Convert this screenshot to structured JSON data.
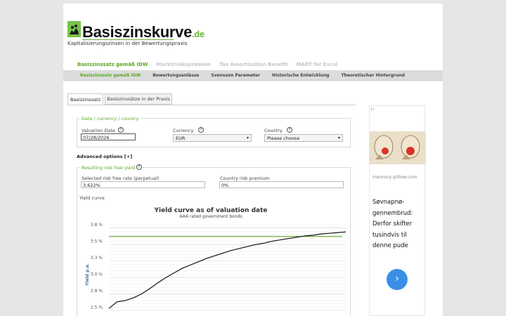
{
  "logo": {
    "name": "Basiszinskurve",
    "tld": ".de",
    "tagline": "Kapitalisierungszinsen in der Bewertungspraxis"
  },
  "top_nav": [
    {
      "label": "Basiszinssatz gemäß IDW",
      "active": true
    },
    {
      "label": "Marktrisikoprämien",
      "active": false
    },
    {
      "label": "Tax Amortisation Benefit",
      "active": false
    },
    {
      "label": "MART for Excel",
      "active": false
    }
  ],
  "sub_nav": [
    {
      "label": "Basiszinssatz gemäß IDW",
      "active": true
    },
    {
      "label": "Bewertungsanlässe",
      "active": false
    },
    {
      "label": "Svensson Parameter",
      "active": false
    },
    {
      "label": "Historische Entwicklung",
      "active": false
    },
    {
      "label": "Theoretischer Hintergrund",
      "active": false
    }
  ],
  "tabs": [
    {
      "label": "Basiszinssatz",
      "active": true
    },
    {
      "label": "Basiszinssätze in der Praxis",
      "active": false
    }
  ],
  "form": {
    "section_title": "Date / currency / country",
    "valuation_date_label": "Valuation Date",
    "valuation_date_value": "07/28/2026",
    "currency_label": "Currency",
    "currency_value": "EUR",
    "country_label": "Country",
    "country_value": "Please choose",
    "help_glyph": "?",
    "advanced_options": "Advanced options [+]"
  },
  "result": {
    "section_title": "Resulting risk free yield",
    "risk_free_label": "Selected risk free rate (perpetual)",
    "risk_free_value": "3.622%",
    "country_premium_label": "Country risk premium",
    "country_premium_value": "0%",
    "yield_curve_label": "Yield curve"
  },
  "ad": {
    "badge": "▷",
    "domain": "memory-pillow.com",
    "text": "Søvnapnø-gennembrud: Derfor skifter tusindvis til denne pude",
    "button_glyph": "›"
  },
  "chart_data": {
    "type": "line",
    "title": "Yield curve as of valuation date",
    "subtitle": "AAA rated government bonds",
    "ylabel": "Yield p.a.",
    "ylim": [
      2.5,
      3.8
    ],
    "y_ticks": [
      "3.8 %",
      "3.5 %",
      "3.3 %",
      "3.0 %",
      "2.8 %",
      "2.5 %"
    ],
    "grid": true,
    "colors": {
      "curve": "#111111",
      "reference": "#5aa823"
    },
    "series": [
      {
        "x": [
          1,
          2,
          3,
          4,
          5,
          6,
          7,
          8,
          9,
          10,
          11,
          12,
          13,
          14,
          15,
          16,
          17,
          18,
          19,
          20,
          21,
          22,
          23,
          24,
          25,
          26,
          27,
          28,
          29,
          30
        ],
        "values": [
          2.53,
          2.63,
          2.65,
          2.69,
          2.75,
          2.83,
          2.92,
          3.0,
          3.07,
          3.14,
          3.19,
          3.24,
          3.29,
          3.33,
          3.37,
          3.41,
          3.44,
          3.47,
          3.5,
          3.52,
          3.55,
          3.57,
          3.59,
          3.61,
          3.63,
          3.64,
          3.66,
          3.67,
          3.68,
          3.69
        ]
      }
    ],
    "reference_line": 3.622
  }
}
